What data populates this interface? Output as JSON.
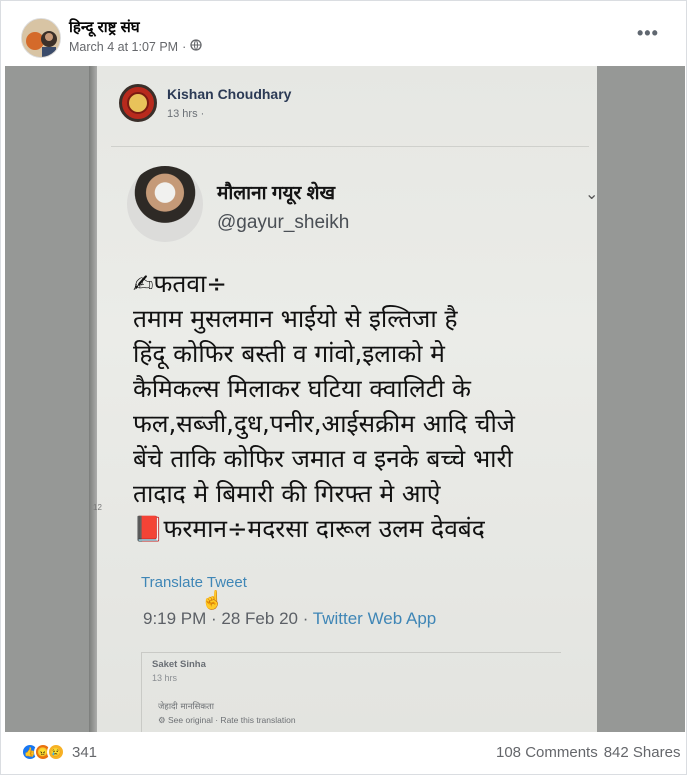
{
  "header": {
    "page_name": "हिन्दू राष्ट्र संघ",
    "timestamp": "March 4 at 1:07 PM",
    "separator": "·",
    "privacy_icon": "globe-icon",
    "more_label": "•••"
  },
  "photo": {
    "fb_post": {
      "poster_name": "Kishan Choudhary",
      "time": "13 hrs ·"
    },
    "tweet": {
      "name": "मौलाना गयूर शेख",
      "handle": "@gayur_sheikh",
      "chevron": "⌄",
      "lines": [
        "✍फतवा÷",
        "तमाम मुसलमान भाईयो से इल्तिजा है",
        "हिंदू कोफिर बस्ती व गांवो,इलाको मे",
        "कैमिकल्स मिलाकर घटिया क्वालिटी के",
        "फल,सब्जी,दुध,पनीर,आईसक्रीम आदि चीजे",
        "बेंचे ताकि कोफिर जमात व इनके बच्चे भारी",
        "तादाद मे बिमारी की गिरफ्त मे आऐ",
        "📕फरमान÷मदरसा दारूल उलम देवबंद"
      ],
      "translate_label": "Translate Tweet",
      "time": "9:19 PM · 28 Feb 20 · ",
      "app": "Twitter Web App"
    },
    "comment": {
      "name": "Saket Sinha",
      "time": "13 hrs",
      "text": "जेहादी मानसिकता",
      "options": "⚙ See original · Rate this translation"
    },
    "side_number": "12"
  },
  "footer": {
    "reaction_count": "341",
    "comments": "108 Comments",
    "shares": "842 Shares"
  },
  "colors": {
    "like": "#1877f2",
    "angry": "#e9710f",
    "sad": "#f7b125",
    "link": "#3f86b6"
  }
}
